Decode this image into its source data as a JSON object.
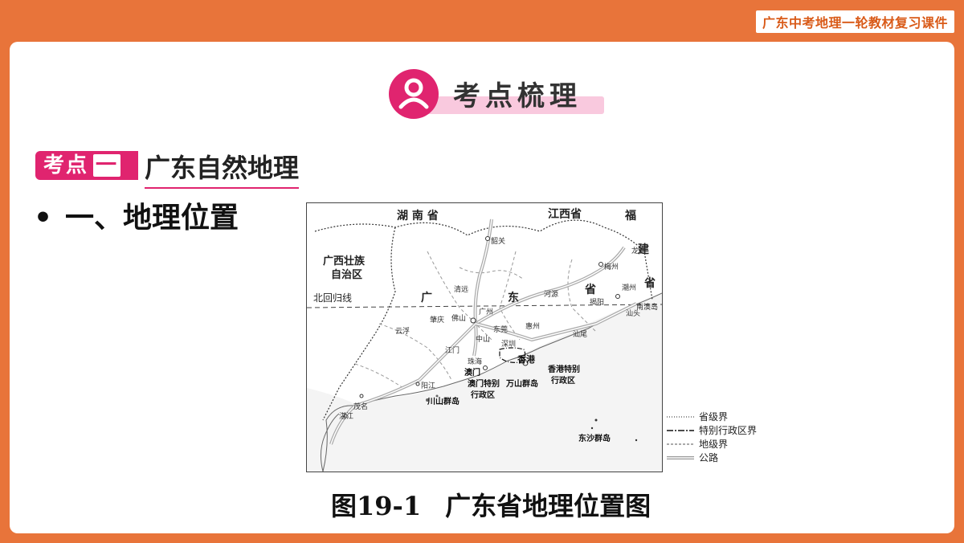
{
  "top_tag": "广东中考地理一轮教材复习课件",
  "section_title": "考点梳理",
  "kaodian": {
    "badge": "考点",
    "badge_num": "一",
    "title": "广东自然地理"
  },
  "bullet": {
    "marker": "•",
    "text": "一、地理位置"
  },
  "map_labels": {
    "hunan": "湖 南 省",
    "jiangxi": "江西省",
    "fu": "福",
    "jian": "建",
    "sheng_fj": "省",
    "guangxi": "广西壮族",
    "guangxi2": "自治区",
    "tropic": "北回归线",
    "guang": "广",
    "dong": "东",
    "sheng_gd": "省",
    "shaoguan": "韶关",
    "longyan": "龙岩",
    "meizhou": "梅州",
    "qingyuan": "清远",
    "guangzhou": "广州",
    "heyuan": "河源",
    "chaozhou": "潮州",
    "shantou": "汕头",
    "jieyang": "揭阳",
    "nanao": "南澳岛",
    "zhaoqing": "肇庆",
    "foshan": "佛山",
    "dongguan": "东莞",
    "huizhou": "惠州",
    "yunfu": "云浮",
    "shanwei": "汕尾",
    "jiangmen": "江门",
    "zhongshan": "中山",
    "shenzhen": "深圳",
    "zhuhai": "珠海",
    "xianggang": "香港",
    "aomen": "澳门",
    "hk_sar": "香港特别",
    "hk_sar2": "行政区",
    "macau_sar": "澳门特别",
    "macau_sar2": "行政区",
    "wanshan": "万山群岛",
    "maoming": "茂名",
    "yangjiang": "阳江",
    "chuanshan": "川山群岛",
    "zhanjiang": "湛江",
    "dongsha": "东沙群岛"
  },
  "legend": [
    {
      "label": "省级界",
      "icon": "dotted-line"
    },
    {
      "label": "特别行政区界",
      "icon": "dash-dot-line"
    },
    {
      "label": "地级界",
      "icon": "dashed-line"
    },
    {
      "label": "公路",
      "icon": "double-line"
    }
  ],
  "caption": {
    "number": "图19-1",
    "title": "广东省地理位置图"
  },
  "colors": {
    "frame": "#e8743a",
    "accent": "#e0246f",
    "accent_light": "#f9c9de",
    "tag_text": "#d95a18"
  }
}
